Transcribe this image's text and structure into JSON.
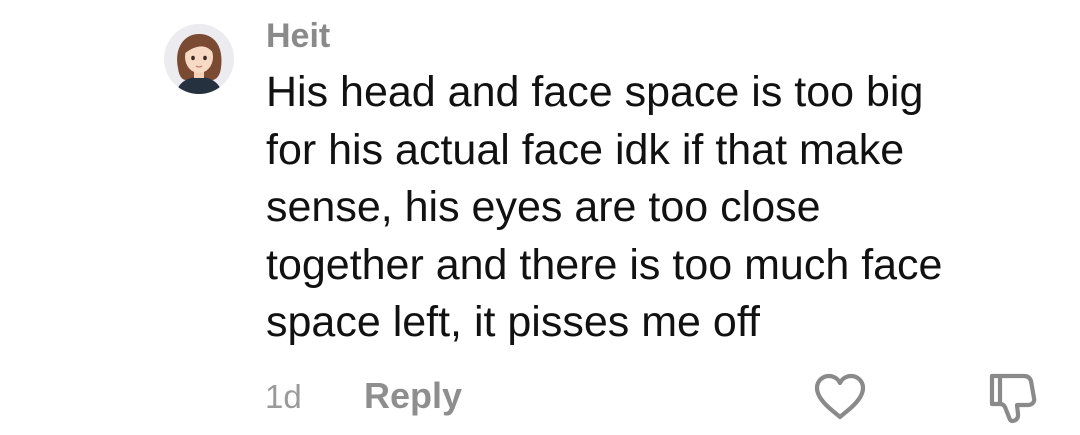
{
  "comment": {
    "username": "Heit",
    "text_lines": [
      "His head and face space is too big",
      "for his actual face idk if that make",
      "sense, his eyes are too close",
      "together and there is too much face",
      "space left, it pisses me off"
    ],
    "timestamp": "1d",
    "reply_label": "Reply"
  },
  "icons": {
    "avatar": "user-avatar-cartoon-girl",
    "like": "heart-outline-icon",
    "dislike": "thumbs-down-outline-icon"
  },
  "colors": {
    "username": "#8a8a8a",
    "text": "#111111",
    "muted": "#9a9a9a",
    "icon": "#8a8a8a"
  }
}
